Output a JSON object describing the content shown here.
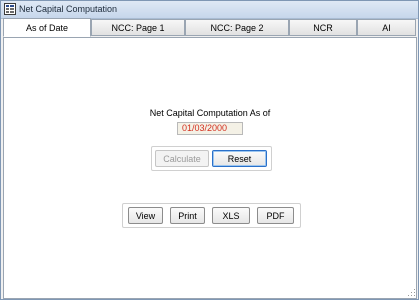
{
  "window": {
    "title": "Net Capital Computation",
    "icon": "app-grid-icon"
  },
  "tabs": [
    {
      "label": "As of Date"
    },
    {
      "label": "NCC: Page 1"
    },
    {
      "label": "NCC: Page 2"
    },
    {
      "label": "NCR"
    },
    {
      "label": "AI"
    }
  ],
  "main": {
    "heading": "Net Capital Computation As of",
    "date_value": "01/03/2000"
  },
  "actions": {
    "calculate_label": "Calculate",
    "reset_label": "Reset"
  },
  "output": {
    "view_label": "View",
    "print_label": "Print",
    "xls_label": "XLS",
    "pdf_label": "PDF"
  },
  "colors": {
    "date_text": "#d32f1e",
    "default_button_border": "#2a70c9"
  }
}
